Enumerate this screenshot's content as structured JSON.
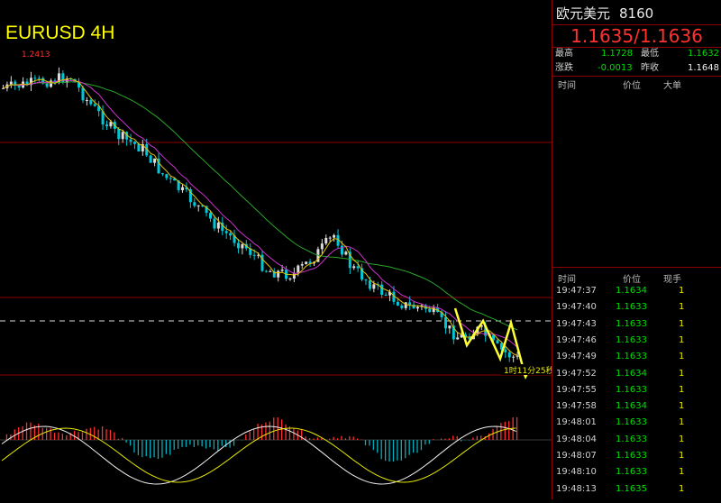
{
  "chart": {
    "title": "EURUSD 4H",
    "high_marker": "1.2413",
    "timer": "1时11分25秒",
    "colors": {
      "ma_fast": "#e6c200",
      "ma_mid": "#cc33cc",
      "ma_slow": "#2aa52a",
      "up_candle": "#dcdcdc",
      "down_candle": "#00c8d8",
      "macd_pos": "#ff3030",
      "macd_neg": "#00b0c0",
      "arrow": "#ffff33",
      "frame": "#8b0000"
    }
  },
  "product": {
    "name": "欧元美元",
    "code": "8160"
  },
  "quote": "1.1635/1.1636",
  "stats": {
    "high_label": "最高",
    "high_value": "1.1728",
    "low_label": "最低",
    "low_value": "1.1632",
    "change_label": "涨跌",
    "change_value": "-0.0013",
    "prev_label": "昨收",
    "prev_value": "1.1648"
  },
  "big_orders": {
    "col_time": "时间",
    "col_price": "价位",
    "col_big": "大单"
  },
  "ticks_header": {
    "col_time": "时间",
    "col_price": "价位",
    "col_volume": "现手"
  },
  "ticks": [
    {
      "time": "19:47:37",
      "price": "1.1634",
      "volume": "1"
    },
    {
      "time": "19:47:40",
      "price": "1.1633",
      "volume": "1"
    },
    {
      "time": "19:47:43",
      "price": "1.1633",
      "volume": "1"
    },
    {
      "time": "19:47:46",
      "price": "1.1633",
      "volume": "1"
    },
    {
      "time": "19:47:49",
      "price": "1.1633",
      "volume": "1"
    },
    {
      "time": "19:47:52",
      "price": "1.1634",
      "volume": "1"
    },
    {
      "time": "19:47:55",
      "price": "1.1633",
      "volume": "1"
    },
    {
      "time": "19:47:58",
      "price": "1.1634",
      "volume": "1"
    },
    {
      "time": "19:48:01",
      "price": "1.1633",
      "volume": "1"
    },
    {
      "time": "19:48:04",
      "price": "1.1633",
      "volume": "1"
    },
    {
      "time": "19:48:07",
      "price": "1.1633",
      "volume": "1"
    },
    {
      "time": "19:48:10",
      "price": "1.1633",
      "volume": "1"
    },
    {
      "time": "19:48:13",
      "price": "1.1635",
      "volume": "1"
    }
  ]
}
